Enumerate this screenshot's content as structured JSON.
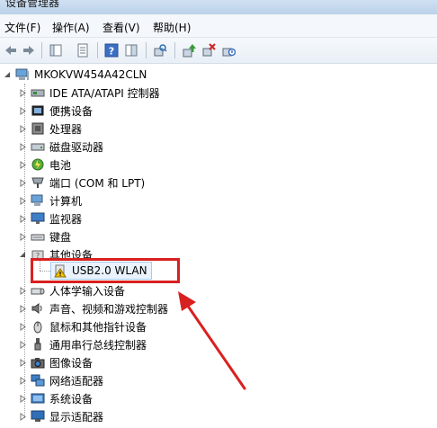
{
  "window": {
    "title": "设备管理器"
  },
  "menu": [
    {
      "label": "文件(F)"
    },
    {
      "label": "操作(A)"
    },
    {
      "label": "查看(V)"
    },
    {
      "label": "帮助(H)"
    }
  ],
  "toolbar": {
    "icons": [
      "back-icon",
      "forward-icon",
      "properties-icon",
      "show-hide-icon",
      "help-icon",
      "console-tree-icon",
      "scan-hardware-icon",
      "update-driver-icon",
      "uninstall-icon",
      "disable-icon"
    ]
  },
  "tree": {
    "root": "MKOKVW454A42CLN",
    "categories": [
      {
        "label": "IDE ATA/ATAPI 控制器",
        "icon": "ide-controller-icon"
      },
      {
        "label": "便携设备",
        "icon": "portable-device-icon"
      },
      {
        "label": "处理器",
        "icon": "processor-icon"
      },
      {
        "label": "磁盘驱动器",
        "icon": "disk-drive-icon"
      },
      {
        "label": "电池",
        "icon": "battery-icon"
      },
      {
        "label": "端口 (COM 和 LPT)",
        "icon": "port-icon"
      },
      {
        "label": "计算机",
        "icon": "computer-icon"
      },
      {
        "label": "监视器",
        "icon": "monitor-icon"
      },
      {
        "label": "键盘",
        "icon": "keyboard-icon"
      },
      {
        "label": "其他设备",
        "icon": "other-devices-icon",
        "expanded": true,
        "children": [
          {
            "label": "USB2.0 WLAN",
            "icon": "warning-device-icon"
          }
        ]
      },
      {
        "label": "人体学输入设备",
        "icon": "hid-icon"
      },
      {
        "label": "声音、视频和游戏控制器",
        "icon": "sound-icon"
      },
      {
        "label": "鼠标和其他指针设备",
        "icon": "mouse-icon"
      },
      {
        "label": "通用串行总线控制器",
        "icon": "usb-icon"
      },
      {
        "label": "图像设备",
        "icon": "imaging-icon"
      },
      {
        "label": "网络适配器",
        "icon": "network-adapter-icon"
      },
      {
        "label": "系统设备",
        "icon": "system-device-icon"
      },
      {
        "label": "显示适配器",
        "icon": "display-adapter-icon"
      }
    ]
  },
  "annotation": {
    "box_color": "#d92020",
    "arrow_color": "#d92020"
  }
}
